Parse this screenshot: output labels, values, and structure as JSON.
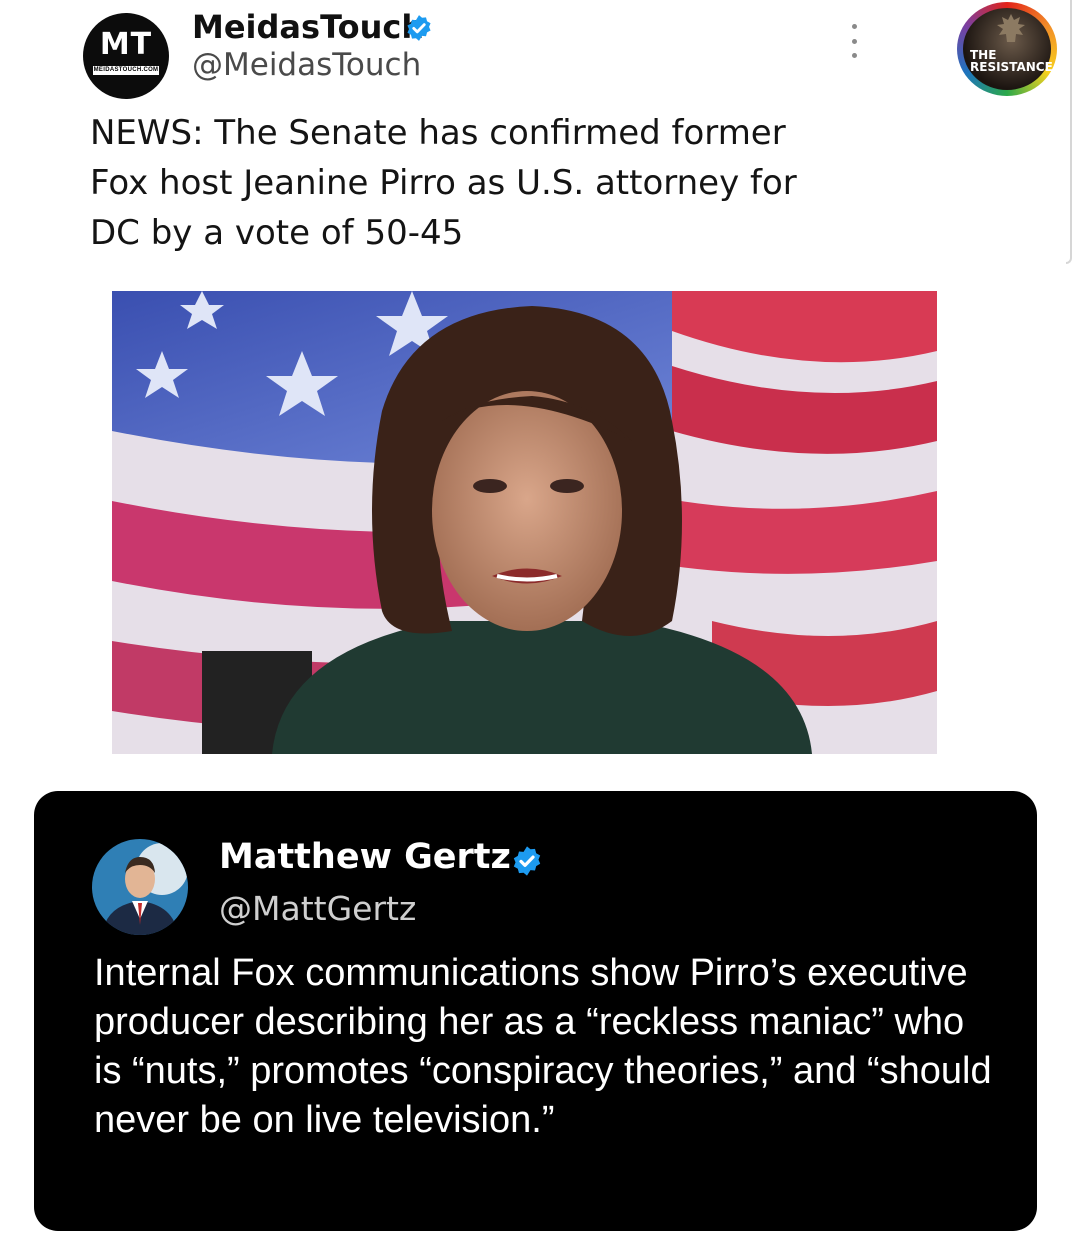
{
  "tweet": {
    "author_name": "MeidasTouch",
    "author_handle": "@MeidasTouch",
    "avatar_text": "MT",
    "avatar_subtext": "MEIDASTOUCH.COM",
    "text": "NEWS: The Senate has confirmed former Fox host Jeanine Pirro as U.S. attorney for DC by a vote of 50-45",
    "verified_icon": "verified-badge-icon",
    "more_icon": "more-vertical-icon"
  },
  "badge": {
    "text_line1": "THE",
    "text_line2": "RESISTANCE"
  },
  "quoted_tweet": {
    "author_name": "Matthew Gertz",
    "author_handle": "@MattGertz",
    "text": "Internal Fox communications show Pirro’s executive producer describing her as a “reckless maniac” who is “nuts,” promotes “conspiracy theories,” and “should never be on live television.”"
  },
  "colors": {
    "verified_blue": "#1d9bf0",
    "quote_card_bg": "#000000"
  }
}
